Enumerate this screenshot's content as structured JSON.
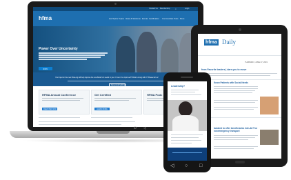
{
  "laptop": {
    "topbar_links": [
      "Contact Us",
      "Membership",
      "Login"
    ],
    "logo": "hfma",
    "nav_items": [
      "Hot Topics",
      "Topics",
      "Ideas & Solutions",
      "Events",
      "Certification",
      "Communities",
      "Tools",
      "More"
    ],
    "hero": {
      "headline": "Power Over Uncertainty",
      "button": "JOIN"
    },
    "survey": {
      "text": "Your input on the new hfma.org will help improve the new Beta! Is it useful to you. Or can it be improved? What's wrong with it? Please tell us!",
      "button": "TAKE OUR SURVEY"
    },
    "cards": [
      {
        "title": "HFMA Annual Conference",
        "button": "REGISTER NOW"
      },
      {
        "title": "Get Certified",
        "button": "LEARN MORE"
      },
      {
        "title": "HFMA Podc",
        "button": ""
      }
    ]
  },
  "tablet": {
    "logo": "hfma",
    "title": "Daily",
    "headlines": [
      "from Favorite leaders | dare you to move",
      "Know Patients with Social Needs",
      "lactated to offer beneficiaries ride-ALT for nonemergency transport"
    ],
    "date_line": "THURSDAY, JUNE 27, 2019"
  },
  "phone": {
    "heading": "Leadership+"
  },
  "icons": {
    "back": "◁",
    "home": "○",
    "recent": "□",
    "power": "⏻"
  }
}
